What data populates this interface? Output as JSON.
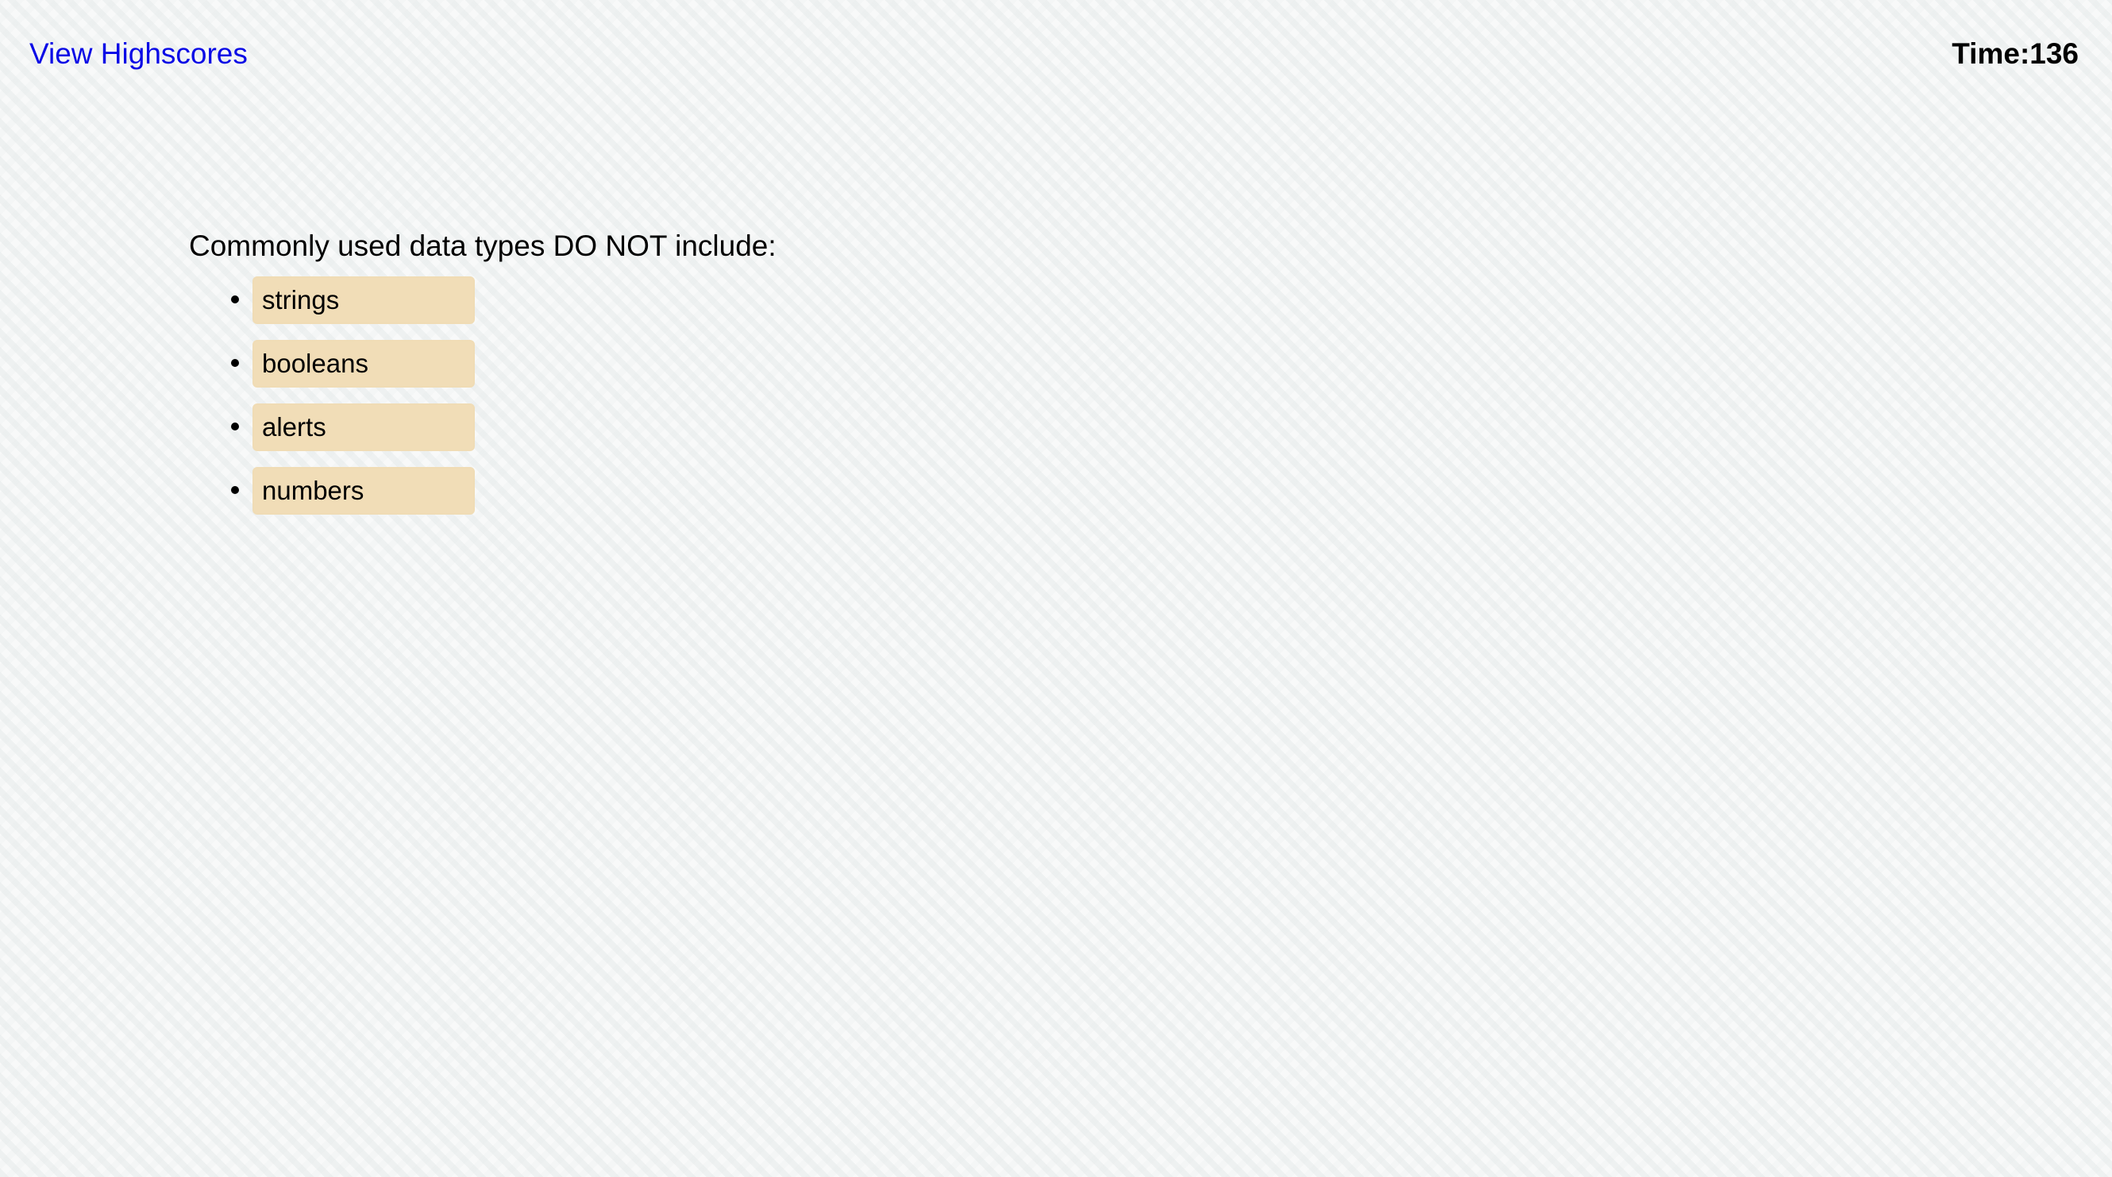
{
  "header": {
    "highscores_link": "View Highscores",
    "timer_label": "Time:",
    "timer_value": "136"
  },
  "quiz": {
    "question": "Commonly used data types DO NOT include:",
    "answers": [
      {
        "label": "strings"
      },
      {
        "label": "booleans"
      },
      {
        "label": "alerts"
      },
      {
        "label": "numbers"
      }
    ]
  },
  "colors": {
    "link": "#0a0ae6",
    "answer_button_bg": "#f1ddb7",
    "background": "#f8f9f9"
  }
}
